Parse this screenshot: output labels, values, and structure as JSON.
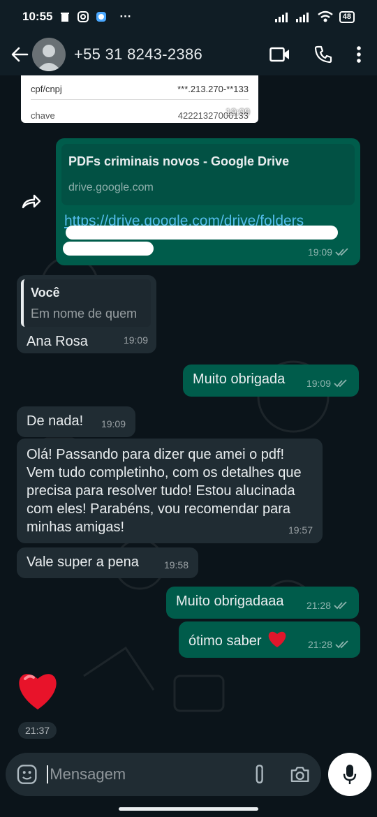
{
  "status_bar": {
    "time": "10:55",
    "dots": "···",
    "battery": "48"
  },
  "header": {
    "contact_name": "+55 31 8243-2386"
  },
  "card": {
    "row1_label": "cpf/cnpj",
    "row1_value": "***.213.270-**133",
    "row2_label": "chave",
    "row2_value": "42221327000133",
    "time": "19:09"
  },
  "messages": {
    "link": {
      "preview_title": "PDFs criminais novos - Google Drive",
      "preview_domain": "drive.google.com",
      "url": "https://drive.google.com/drive/folders",
      "time": "19:09"
    },
    "reply": {
      "quote_author": "Você",
      "quote_text": "Em nome de quem",
      "text": "Ana Rosa",
      "time": "19:09"
    },
    "m1": {
      "text": "Muito obrigada",
      "time": "19:09"
    },
    "m2": {
      "text": "De nada!",
      "time": "19:09"
    },
    "m3": {
      "text": "Olá! Passando para dizer que amei o pdf! Vem tudo completinho, com os detalhes que precisa para resolver tudo! Estou alucinada com eles! Parabéns, vou recomendar para minhas amigas!",
      "time": "19:57"
    },
    "m4": {
      "text": "Vale super a pena",
      "time": "19:58"
    },
    "m5": {
      "text": "Muito obrigadaaa",
      "time": "21:28"
    },
    "m6": {
      "text": "ótimo saber",
      "time": "21:28"
    },
    "heart_time": "21:37"
  },
  "input": {
    "placeholder": "Mensagem"
  },
  "colors": {
    "incoming": "#202c33",
    "outgoing": "#005c4b",
    "link": "#53bdeb",
    "background": "#0b141a"
  }
}
